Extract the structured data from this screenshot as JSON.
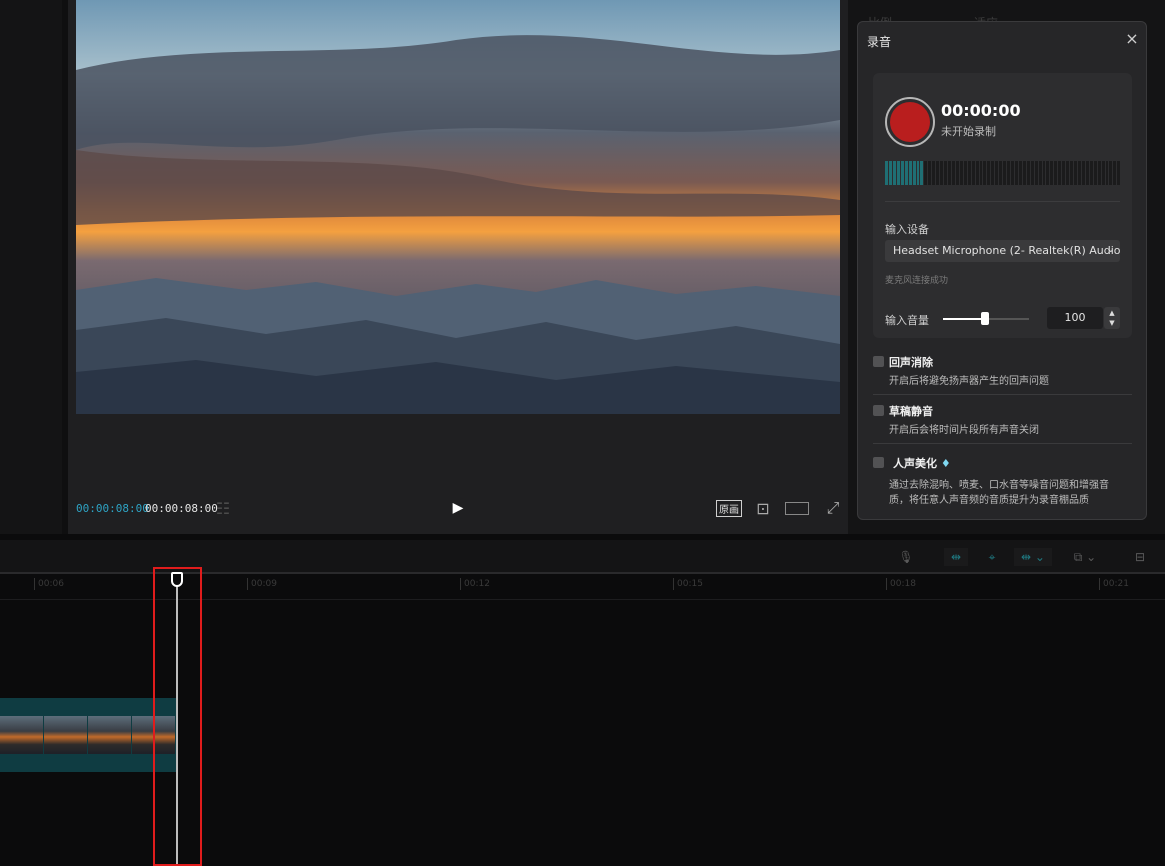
{
  "player": {
    "current_time": "00:00:08:00",
    "total_time": "00:00:08:00",
    "ratio_label": "原画"
  },
  "right_panel": {
    "faint_tabs": [
      "比例",
      "适应"
    ]
  },
  "record_dialog": {
    "title": "录音",
    "close_icon": "×",
    "timer": "00:00:00",
    "status": "未开始录制",
    "meter_level": 0.17,
    "device_label": "输入设备",
    "device_value": "Headset Microphone (2- Realtek(R) Audio)",
    "device_status": "麦克风连接成功",
    "volume_label": "输入音量",
    "volume_value": "100",
    "volume_slider_fraction": 0.5,
    "options": [
      {
        "title": "回声消除",
        "desc": "开启后将避免扬声器产生的回声问题",
        "checked": false
      },
      {
        "title": "草稿静音",
        "desc": "开启后会将时间片段所有声音关闭",
        "checked": false
      },
      {
        "title": "人声美化",
        "desc": "通过去除混响、喷麦、口水音等噪音问题和增强音质，将任意人声音频的音质提升为录音棚品质",
        "checked": false,
        "premium": true
      }
    ]
  },
  "timeline": {
    "ruler_ticks": [
      "00:06",
      "00:09",
      "00:12",
      "00:15",
      "00:18",
      "00:21"
    ]
  },
  "colors": {
    "accent_teal": "#1f7880",
    "record_red": "#b91e1e",
    "highlight_red": "#e01c1c",
    "timecode_blue": "#2ea3c4"
  }
}
